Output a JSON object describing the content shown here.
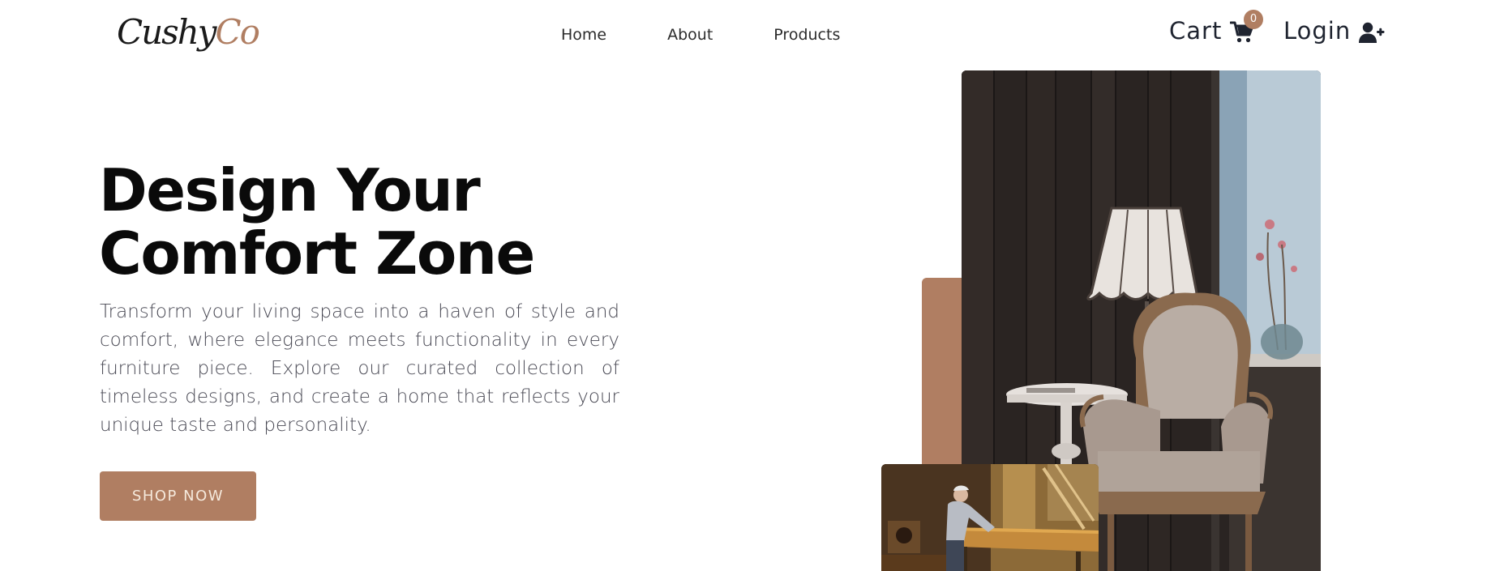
{
  "header": {
    "logo": {
      "part1": "Cushy",
      "part2": "Co"
    },
    "nav": {
      "home": "Home",
      "about": "About",
      "products": "Products"
    },
    "cart": {
      "label": "Cart",
      "count": "0"
    },
    "login": {
      "label": "Login"
    }
  },
  "hero": {
    "title_line1": "Design Your",
    "title_line2": "Comfort Zone",
    "description": "Transform your living space into a haven of style and comfort, where elegance meets functionality in every furniture piece. Explore our curated collection of timeless designs, and create a home that reflects your unique taste and personality.",
    "cta": "SHOP NOW"
  },
  "colors": {
    "accent": "#b07e62",
    "text_dark": "#0a0a0a",
    "text_body": "#4a4a55"
  },
  "icons": {
    "cart": "cart-icon",
    "login": "user-plus-icon"
  }
}
